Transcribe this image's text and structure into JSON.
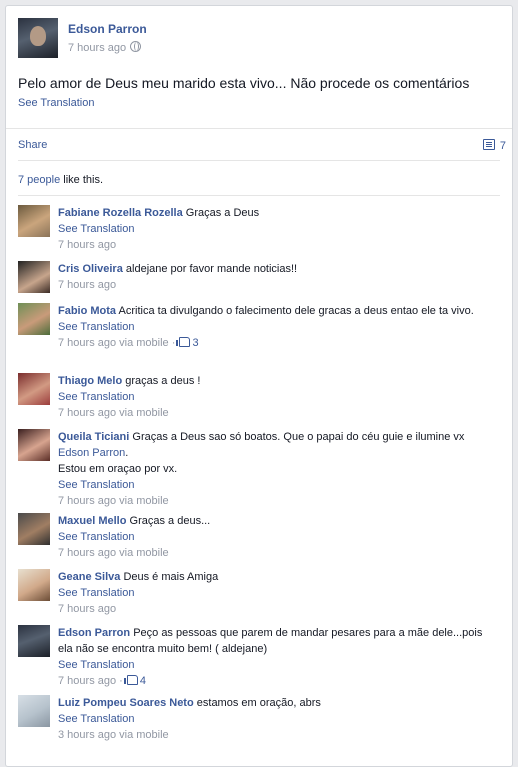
{
  "post": {
    "author": "Edson Parron",
    "time": "7 hours ago",
    "text": "Pelo amor de Deus meu marido esta vivo... Não procede os comentários",
    "translate": "See Translation"
  },
  "actions": {
    "share": "Share",
    "comment_count": "7"
  },
  "likes": {
    "count_text": "7 people",
    "suffix": " like this."
  },
  "comments": [
    {
      "name": "Fabiane Rozella Rozella",
      "text": "Graças a Deus",
      "translate": "See Translation",
      "meta": "7 hours ago"
    },
    {
      "name": "Cris Oliveira",
      "text": "aldejane por favor mande noticias!!",
      "translate": "See Translation",
      "meta": "7 hours ago"
    },
    {
      "name": "Fabio Mota",
      "text": "Acritica ta divulgando o falecimento dele gracas a deus entao ele ta vivo.",
      "translate": "See Translation",
      "meta": "7 hours ago via mobile · ",
      "likes": "3"
    },
    {
      "name": "Thiago Melo",
      "text": "graças a deus !",
      "translate": "See Translation",
      "meta": "7 hours ago via mobile"
    },
    {
      "name": "Queila Ticiani",
      "text": "Graças a Deus sao só boatos. Que o papai do céu guie e ilumine vx ",
      "mention": "Edson Parron",
      "text2": ".",
      "text3": "Estou em oraçao por vx.",
      "translate": "See Translation",
      "meta": "7 hours ago via mobile"
    },
    {
      "name": "Maxuel Mello",
      "text": "Graças a deus...",
      "translate": "See Translation",
      "meta": "7 hours ago via mobile"
    },
    {
      "name": "Geane Silva",
      "text": "Deus é mais Amiga",
      "translate": "See Translation",
      "meta": "7 hours ago"
    },
    {
      "name": "Edson Parron",
      "text": "Peço as pessoas que parem de mandar pesares para a mãe dele...pois ela não se encontra muito bem! ( aldejane)",
      "translate": "See Translation",
      "meta": "7 hours ago · ",
      "likes": "4"
    },
    {
      "name": "Luiz Pompeu Soares Neto",
      "text": "estamos em oração, abrs",
      "translate": "See Translation",
      "meta": "3 hours ago via mobile"
    }
  ]
}
